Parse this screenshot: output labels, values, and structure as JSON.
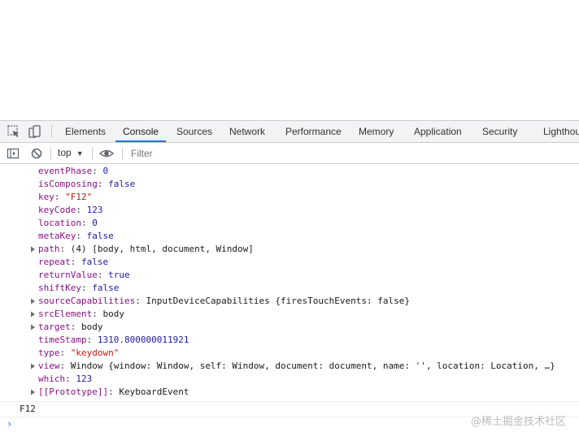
{
  "tabs": [
    {
      "label": "Elements"
    },
    {
      "label": "Console"
    },
    {
      "label": "Sources"
    },
    {
      "label": "Network"
    },
    {
      "label": "Performance"
    },
    {
      "label": "Memory"
    },
    {
      "label": "Application"
    },
    {
      "label": "Security"
    },
    {
      "label": "Lighthouse"
    }
  ],
  "active_tab": "Console",
  "toolbar": {
    "context": "top",
    "filter_placeholder": "Filter"
  },
  "console": {
    "properties": [
      {
        "key": "eventPhase",
        "value": "0",
        "type": "num",
        "expandable": false
      },
      {
        "key": "isComposing",
        "value": "false",
        "type": "bool",
        "expandable": false
      },
      {
        "key": "key",
        "value": "\"F12\"",
        "type": "str",
        "expandable": false
      },
      {
        "key": "keyCode",
        "value": "123",
        "type": "num",
        "expandable": false
      },
      {
        "key": "location",
        "value": "0",
        "type": "num",
        "expandable": false
      },
      {
        "key": "metaKey",
        "value": "false",
        "type": "bool",
        "expandable": false
      },
      {
        "key": "path",
        "value": "(4) [body, html, document, Window]",
        "type": "obj",
        "expandable": true
      },
      {
        "key": "repeat",
        "value": "false",
        "type": "bool",
        "expandable": false
      },
      {
        "key": "returnValue",
        "value": "true",
        "type": "bool",
        "expandable": false
      },
      {
        "key": "shiftKey",
        "value": "false",
        "type": "bool",
        "expandable": false
      },
      {
        "key": "sourceCapabilities",
        "value": "InputDeviceCapabilities {firesTouchEvents: false}",
        "type": "obj",
        "expandable": true
      },
      {
        "key": "srcElement",
        "value": "body",
        "type": "obj",
        "expandable": true
      },
      {
        "key": "target",
        "value": "body",
        "type": "obj",
        "expandable": true
      },
      {
        "key": "timeStamp",
        "value": "1310.800000011921",
        "type": "num",
        "expandable": false
      },
      {
        "key": "type",
        "value": "\"keydown\"",
        "type": "str",
        "expandable": false
      },
      {
        "key": "view",
        "value": "Window {window: Window, self: Window, document: document, name: '', location: Location, …}",
        "type": "obj",
        "expandable": true
      },
      {
        "key": "which",
        "value": "123",
        "type": "num",
        "expandable": false
      },
      {
        "key": "[[Prototype]]",
        "value": "KeyboardEvent",
        "type": "obj",
        "expandable": true
      }
    ],
    "log_output": "F12"
  },
  "watermark": "@稀土掘金技术社区",
  "colors": {
    "accent": "#1a73e8",
    "key": "#881280",
    "number": "#1a1aa6",
    "string": "#c41a16"
  }
}
